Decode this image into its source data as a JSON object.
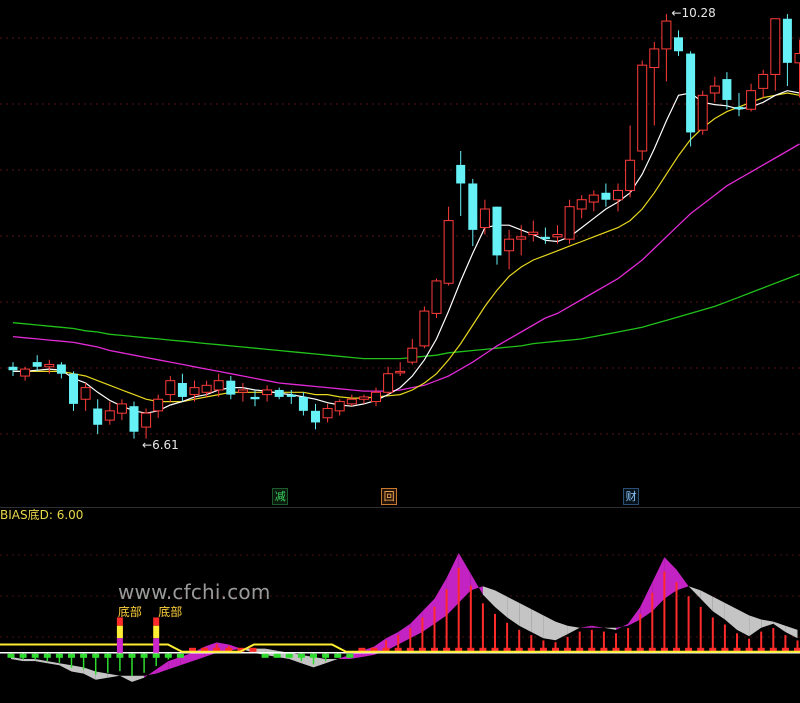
{
  "colors": {
    "background": "#000000",
    "up": "#ff3b3b",
    "down": "#66f1f6",
    "ma_white": "#ffffff",
    "ma_yellow": "#e8d81f",
    "ma_magenta": "#e02ad5",
    "ma_green": "#21c11b",
    "grid": "#7a1d1d",
    "bias_magenta": "#cc25cc",
    "bias_gray": "#cfcfcf",
    "bias_red": "#ff2a2a",
    "bias_green": "#2fdc2f",
    "bias_yellow_line": "#ffee33"
  },
  "price_labels": {
    "high": "10.28",
    "low": "6.61"
  },
  "markers": [
    {
      "text": "减",
      "style": "green"
    },
    {
      "text": "回",
      "style": "orange"
    },
    {
      "text": "财",
      "style": "blue"
    }
  ],
  "bottom_panel": {
    "title": "BIAS底D: 6.00",
    "labels": [
      "底部",
      "底部"
    ],
    "watermark": "www.cfchi.com"
  },
  "chart_data": [
    {
      "type": "candlestick",
      "ylim": [
        6.35,
        10.35
      ],
      "grid": true,
      "high_label": "10.28",
      "low_label": "6.61",
      "candles": [
        [
          7.24,
          7.28,
          7.16,
          7.21
        ],
        [
          7.16,
          7.24,
          7.12,
          7.22
        ],
        [
          7.28,
          7.34,
          7.2,
          7.24
        ],
        [
          7.24,
          7.3,
          7.18,
          7.26
        ],
        [
          7.26,
          7.28,
          7.14,
          7.18
        ],
        [
          7.18,
          7.2,
          6.86,
          6.92
        ],
        [
          6.96,
          7.1,
          6.86,
          7.06
        ],
        [
          6.88,
          6.96,
          6.66,
          6.74
        ],
        [
          6.78,
          6.94,
          6.74,
          6.86
        ],
        [
          6.84,
          6.96,
          6.78,
          6.92
        ],
        [
          6.9,
          6.94,
          6.62,
          6.68
        ],
        [
          6.72,
          6.88,
          6.62,
          6.84
        ],
        [
          6.86,
          7.0,
          6.8,
          6.96
        ],
        [
          7.0,
          7.16,
          6.94,
          7.12
        ],
        [
          7.1,
          7.18,
          6.94,
          6.98
        ],
        [
          7.0,
          7.12,
          6.94,
          7.06
        ],
        [
          7.02,
          7.12,
          6.98,
          7.08
        ],
        [
          7.04,
          7.18,
          6.98,
          7.12
        ],
        [
          7.12,
          7.16,
          6.96,
          7.0
        ],
        [
          7.02,
          7.1,
          6.94,
          7.04
        ],
        [
          6.98,
          7.04,
          6.9,
          6.96
        ],
        [
          7.0,
          7.08,
          6.94,
          7.04
        ],
        [
          7.04,
          7.06,
          6.96,
          6.98
        ],
        [
          7.0,
          7.04,
          6.92,
          6.98
        ],
        [
          6.98,
          7.02,
          6.82,
          6.86
        ],
        [
          6.86,
          6.92,
          6.7,
          6.76
        ],
        [
          6.8,
          6.92,
          6.76,
          6.88
        ],
        [
          6.86,
          6.96,
          6.82,
          6.94
        ],
        [
          6.92,
          7.0,
          6.9,
          6.96
        ],
        [
          6.96,
          7.0,
          6.92,
          6.98
        ],
        [
          6.94,
          7.06,
          6.9,
          7.02
        ],
        [
          7.02,
          7.24,
          7.0,
          7.18
        ],
        [
          7.2,
          7.28,
          7.16,
          7.2
        ],
        [
          7.28,
          7.48,
          7.26,
          7.4
        ],
        [
          7.42,
          7.76,
          7.4,
          7.72
        ],
        [
          7.7,
          8.0,
          7.66,
          7.98
        ],
        [
          7.96,
          8.62,
          7.94,
          8.5
        ],
        [
          8.98,
          9.1,
          8.54,
          8.82
        ],
        [
          8.82,
          8.86,
          8.28,
          8.42
        ],
        [
          8.44,
          8.68,
          8.38,
          8.6
        ],
        [
          8.62,
          8.62,
          8.12,
          8.2
        ],
        [
          8.24,
          8.42,
          8.08,
          8.34
        ],
        [
          8.34,
          8.46,
          8.2,
          8.36
        ],
        [
          8.38,
          8.5,
          8.32,
          8.4
        ],
        [
          8.36,
          8.44,
          8.3,
          8.34
        ],
        [
          8.36,
          8.46,
          8.3,
          8.38
        ],
        [
          8.34,
          8.68,
          8.3,
          8.62
        ],
        [
          8.6,
          8.72,
          8.52,
          8.68
        ],
        [
          8.66,
          8.76,
          8.58,
          8.72
        ],
        [
          8.74,
          8.82,
          8.62,
          8.68
        ],
        [
          8.68,
          8.82,
          8.58,
          8.76
        ],
        [
          8.76,
          9.32,
          8.7,
          9.02
        ],
        [
          9.1,
          9.88,
          9.02,
          9.84
        ],
        [
          9.82,
          10.04,
          9.32,
          9.98
        ],
        [
          9.98,
          10.28,
          9.7,
          10.22
        ],
        [
          10.08,
          10.14,
          9.92,
          9.96
        ],
        [
          9.94,
          9.96,
          9.14,
          9.26
        ],
        [
          9.28,
          9.62,
          9.24,
          9.58
        ],
        [
          9.6,
          9.74,
          9.52,
          9.66
        ],
        [
          9.72,
          9.78,
          9.46,
          9.54
        ],
        [
          9.48,
          9.6,
          9.4,
          9.46
        ],
        [
          9.46,
          9.68,
          9.44,
          9.62
        ],
        [
          9.64,
          9.8,
          9.56,
          9.76
        ],
        [
          9.76,
          10.22,
          9.62,
          10.24
        ],
        [
          10.24,
          10.28,
          9.66,
          9.86
        ],
        [
          9.86,
          10.06,
          9.56,
          9.94
        ]
      ],
      "ma_white": [
        7.2,
        7.2,
        7.21,
        7.22,
        7.21,
        7.14,
        7.1,
        7.02,
        6.95,
        6.9,
        6.86,
        6.84,
        6.86,
        6.91,
        6.94,
        6.98,
        7.0,
        7.04,
        7.06,
        7.06,
        7.04,
        7.03,
        7.01,
        7.0,
        6.98,
        6.96,
        6.93,
        6.91,
        6.9,
        6.92,
        6.95,
        7.0,
        7.06,
        7.16,
        7.3,
        7.48,
        7.72,
        7.98,
        8.22,
        8.44,
        8.46,
        8.46,
        8.42,
        8.38,
        8.33,
        8.32,
        8.36,
        8.44,
        8.52,
        8.6,
        8.66,
        8.74,
        8.9,
        9.12,
        9.36,
        9.58,
        9.6,
        9.52,
        9.5,
        9.49,
        9.46,
        9.48,
        9.52,
        9.58,
        9.62,
        9.6
      ],
      "ma_yellow": [
        7.2,
        7.2,
        7.2,
        7.2,
        7.2,
        7.18,
        7.16,
        7.12,
        7.08,
        7.04,
        7.0,
        6.96,
        6.94,
        6.94,
        6.94,
        6.96,
        6.98,
        7.0,
        7.02,
        7.02,
        7.02,
        7.02,
        7.02,
        7.02,
        7.02,
        7.0,
        7.0,
        6.98,
        6.97,
        6.97,
        6.98,
        6.99,
        7.0,
        7.04,
        7.1,
        7.18,
        7.3,
        7.44,
        7.6,
        7.76,
        7.9,
        8.02,
        8.1,
        8.16,
        8.2,
        8.24,
        8.28,
        8.32,
        8.36,
        8.4,
        8.44,
        8.5,
        8.6,
        8.74,
        8.9,
        9.06,
        9.2,
        9.3,
        9.38,
        9.44,
        9.48,
        9.52,
        9.56,
        9.58,
        9.6,
        9.58
      ],
      "ma_magenta": [
        7.5,
        7.49,
        7.48,
        7.47,
        7.46,
        7.45,
        7.43,
        7.41,
        7.38,
        7.36,
        7.34,
        7.32,
        7.3,
        7.28,
        7.26,
        7.24,
        7.22,
        7.2,
        7.18,
        7.16,
        7.14,
        7.12,
        7.1,
        7.09,
        7.08,
        7.07,
        7.06,
        7.05,
        7.04,
        7.03,
        7.03,
        7.03,
        7.04,
        7.06,
        7.08,
        7.12,
        7.16,
        7.22,
        7.28,
        7.35,
        7.42,
        7.48,
        7.54,
        7.6,
        7.66,
        7.7,
        7.76,
        7.82,
        7.88,
        7.94,
        8.0,
        8.08,
        8.16,
        8.26,
        8.36,
        8.46,
        8.56,
        8.64,
        8.72,
        8.8,
        8.86,
        8.92,
        8.98,
        9.04,
        9.1,
        9.16
      ],
      "ma_green": [
        7.62,
        7.61,
        7.6,
        7.59,
        7.58,
        7.57,
        7.55,
        7.54,
        7.52,
        7.51,
        7.5,
        7.49,
        7.48,
        7.47,
        7.46,
        7.45,
        7.44,
        7.43,
        7.42,
        7.41,
        7.4,
        7.39,
        7.38,
        7.37,
        7.36,
        7.35,
        7.34,
        7.33,
        7.32,
        7.31,
        7.31,
        7.31,
        7.31,
        7.32,
        7.33,
        7.34,
        7.36,
        7.37,
        7.38,
        7.39,
        7.4,
        7.41,
        7.42,
        7.44,
        7.45,
        7.46,
        7.47,
        7.48,
        7.5,
        7.52,
        7.54,
        7.56,
        7.58,
        7.61,
        7.64,
        7.67,
        7.7,
        7.73,
        7.76,
        7.8,
        7.84,
        7.88,
        7.92,
        7.96,
        8.0,
        8.04
      ]
    },
    {
      "type": "bar",
      "title": "BIAS底D: 6.00",
      "ylim": [
        -15,
        60
      ],
      "bias_line": [
        -3,
        -4,
        -4,
        -5,
        -6,
        -9,
        -10,
        -13,
        -12,
        -11,
        -14,
        -12,
        -8,
        -4,
        -2,
        0,
        3,
        5,
        4,
        2,
        0,
        -1,
        -2,
        -3,
        -5,
        -7,
        -5,
        -3,
        -1,
        1,
        3,
        7,
        10,
        14,
        20,
        26,
        36,
        48,
        38,
        28,
        22,
        17,
        13,
        10,
        7,
        6,
        9,
        12,
        13,
        12,
        11,
        14,
        22,
        34,
        46,
        40,
        32,
        26,
        20,
        16,
        11,
        8,
        12,
        14,
        10,
        7
      ],
      "bias_ma": [
        -2,
        -3,
        -3,
        -4,
        -5,
        -6,
        -7,
        -9,
        -10,
        -11,
        -11,
        -11,
        -10,
        -8,
        -6,
        -4,
        -2,
        0,
        1,
        2,
        2,
        2,
        1,
        0,
        -1,
        -2,
        -3,
        -3,
        -3,
        -2,
        -1,
        1,
        4,
        7,
        10,
        14,
        18,
        24,
        30,
        32,
        30,
        27,
        24,
        21,
        18,
        15,
        13,
        12,
        12,
        12,
        12,
        13,
        16,
        20,
        26,
        30,
        32,
        30,
        27,
        24,
        21,
        18,
        16,
        15,
        13,
        11
      ]
    }
  ]
}
